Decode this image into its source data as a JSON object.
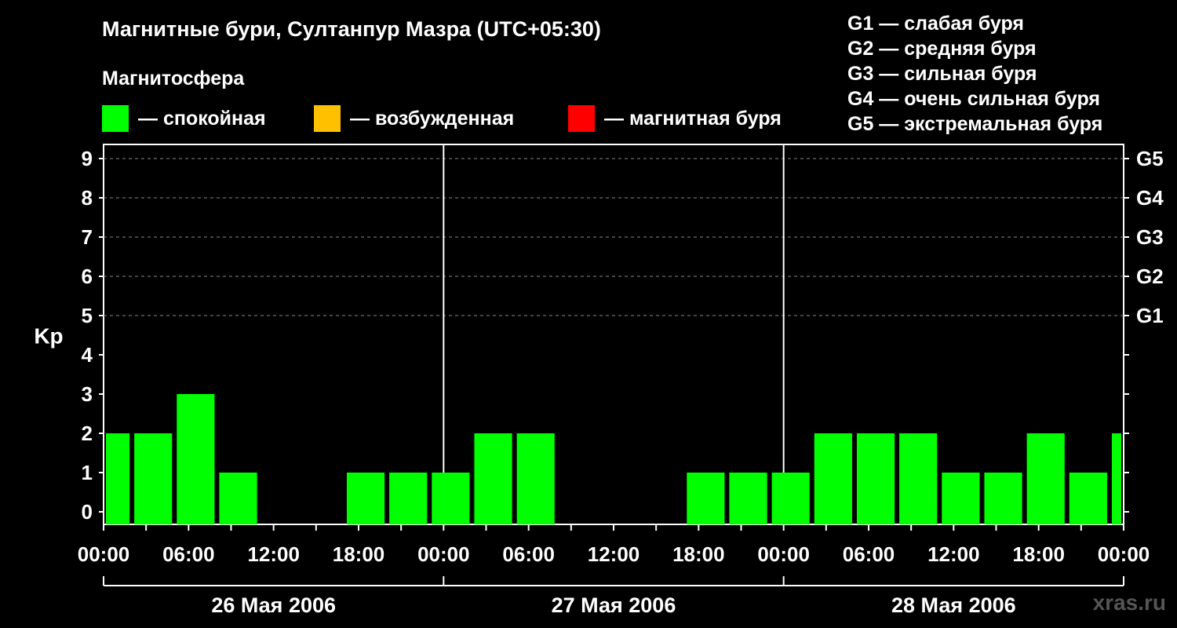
{
  "title": "Магнитные бури, Султанпур Мазра (UTC+05:30)",
  "subtitle": "Магнитосфера",
  "legend": [
    {
      "label": "— спокойная",
      "color": "#00ff00"
    },
    {
      "label": "— возбужденная",
      "color": "#ffc000"
    },
    {
      "label": "— магнитная буря",
      "color": "#ff0000"
    }
  ],
  "storm_levels": [
    "G1 — слабая буря",
    "G2 — средняя буря",
    "G3 — сильная буря",
    "G4 — очень сильная буря",
    "G5 — экстремальная буря"
  ],
  "watermark": "xras.ru",
  "chart_data": {
    "type": "bar",
    "ylabel": "Kp",
    "ylim": [
      0,
      9
    ],
    "yticks": [
      0,
      1,
      2,
      3,
      4,
      5,
      6,
      7,
      8,
      9
    ],
    "right_axis": [
      {
        "kp": 5,
        "label": "G1"
      },
      {
        "kp": 6,
        "label": "G2"
      },
      {
        "kp": 7,
        "label": "G3"
      },
      {
        "kp": 8,
        "label": "G4"
      },
      {
        "kp": 9,
        "label": "G5"
      }
    ],
    "x_range_hours": [
      0,
      72
    ],
    "xtick_labels": [
      "00:00",
      "06:00",
      "12:00",
      "18:00",
      "00:00",
      "06:00",
      "12:00",
      "18:00",
      "00:00",
      "06:00",
      "12:00",
      "18:00",
      "00:00"
    ],
    "days": [
      "26 Мая 2006",
      "27 Мая 2006",
      "28 Мая 2006"
    ],
    "series": [
      {
        "color": "#00ff00",
        "start_hour": [
          0,
          2,
          5,
          8,
          11,
          14,
          17,
          20,
          23,
          26,
          29,
          32,
          35,
          38,
          41,
          44,
          47,
          50,
          53,
          56,
          59,
          62,
          65,
          68,
          71
        ],
        "end_hour": [
          2,
          5,
          8,
          11,
          14,
          17,
          20,
          23,
          26,
          29,
          32,
          35,
          38,
          41,
          44,
          47,
          50,
          53,
          56,
          59,
          62,
          65,
          68,
          71,
          72
        ],
        "values": [
          2,
          2,
          3,
          1,
          0,
          0,
          1,
          1,
          1,
          2,
          2,
          0,
          0,
          0,
          1,
          1,
          1,
          2,
          2,
          2,
          1,
          1,
          2,
          1,
          2
        ]
      }
    ],
    "grid": true,
    "legend_position": "top"
  }
}
